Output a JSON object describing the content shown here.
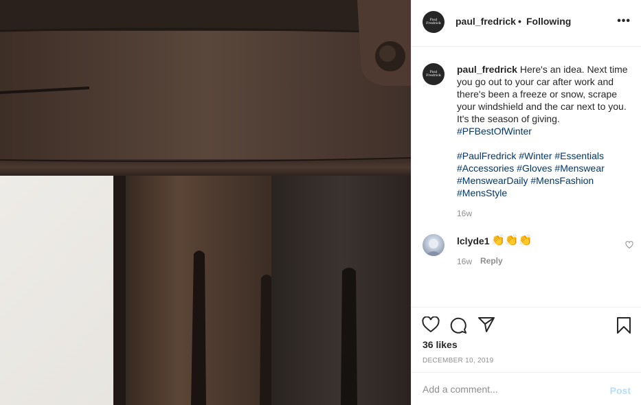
{
  "post": {
    "image_alt": "Close-up photo of brown leather gloves",
    "author": {
      "username": "paul_fredrick",
      "avatar_text_line1": "Paul",
      "avatar_text_line2": "Fredrick",
      "follow_separator": "•",
      "follow_status": "Following"
    },
    "more_label": "•••",
    "caption": {
      "username": "paul_fredrick",
      "text": "Here's an idea. Next time you go out to your car after work and there's been a freeze or snow, scrape your windshield and the car next to you. It's the season of giving.",
      "hashtag_line1": "#PFBestOfWinter",
      "hashtags": [
        "#PaulFredrick",
        "#Winter",
        "#Essentials",
        "#Accessories",
        "#Gloves",
        "#Menswear",
        "#MenswearDaily",
        "#MensFashion",
        "#MensStyle"
      ],
      "time": "16w"
    },
    "comments": [
      {
        "username": "lclyde1",
        "text": "👏👏👏",
        "time": "16w",
        "reply_label": "Reply"
      }
    ],
    "actions": {
      "like_icon": "heart-icon",
      "comment_icon": "comment-icon",
      "share_icon": "paper-plane-icon",
      "save_icon": "bookmark-icon"
    },
    "likes": "36 likes",
    "date": "DECEMBER 10, 2019",
    "add_comment": {
      "placeholder": "Add a comment...",
      "post_label": "Post",
      "post_color": "#b2dffc"
    },
    "colors": {
      "hashtag": "#00376b",
      "muted": "#8e8e8e",
      "text": "#262626"
    }
  }
}
